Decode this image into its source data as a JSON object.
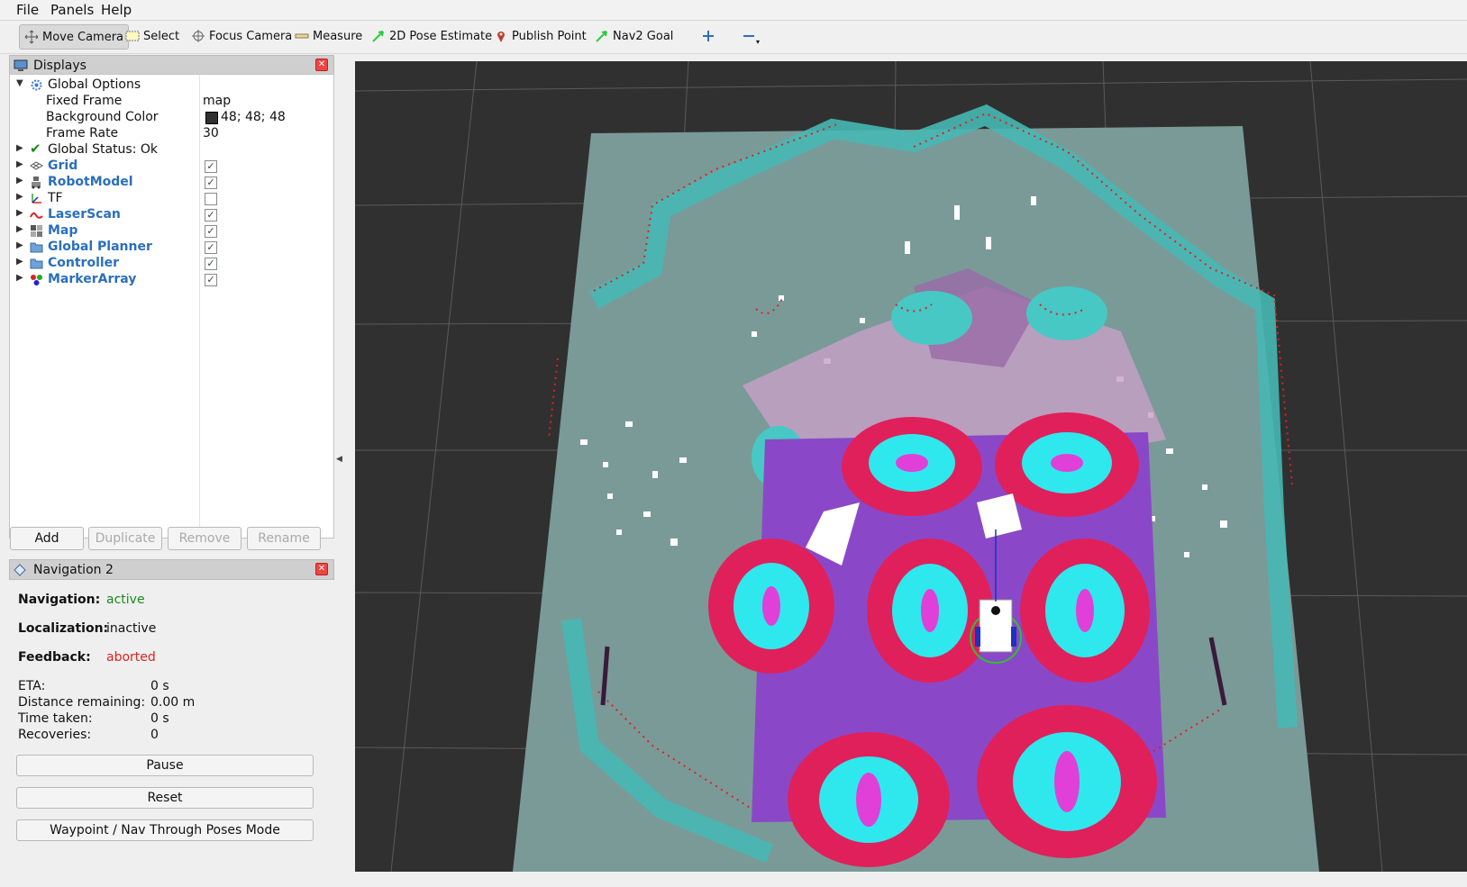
{
  "menubar": {
    "items": [
      "File",
      "Panels",
      "Help"
    ]
  },
  "toolbar": {
    "tools": [
      {
        "label": "Move Camera",
        "icon": "move-camera-icon",
        "active": true
      },
      {
        "label": "Select",
        "icon": "select-icon"
      },
      {
        "label": "Focus Camera",
        "icon": "focus-camera-icon"
      },
      {
        "label": "Measure",
        "icon": "measure-icon"
      },
      {
        "label": "2D Pose Estimate",
        "icon": "pose-arrow-icon",
        "color": "#2ecc40"
      },
      {
        "label": "Publish Point",
        "icon": "map-pin-icon",
        "color": "#c0392b"
      },
      {
        "label": "Nav2 Goal",
        "icon": "goal-arrow-icon",
        "color": "#2ecc40"
      }
    ],
    "add_tool_icon": "plus-icon",
    "remove_tool_icon": "minus-icon"
  },
  "displays": {
    "title": "Displays",
    "global_options": {
      "label": "Global Options",
      "fixed_frame_label": "Fixed Frame",
      "fixed_frame_value": "map",
      "bg_color_label": "Background Color",
      "bg_color_value": "48; 48; 48",
      "bg_color_hex": "#303030",
      "frame_rate_label": "Frame Rate",
      "frame_rate_value": "30"
    },
    "global_status": "Global Status: Ok",
    "items": [
      {
        "label": "Grid",
        "checked": true,
        "icon": "grid-icon"
      },
      {
        "label": "RobotModel",
        "checked": true,
        "icon": "robot-icon"
      },
      {
        "label": "TF",
        "checked": false,
        "icon": "tf-axes-icon"
      },
      {
        "label": "LaserScan",
        "checked": true,
        "icon": "laser-scan-icon"
      },
      {
        "label": "Map",
        "checked": true,
        "icon": "map-icon"
      },
      {
        "label": "Global Planner",
        "checked": true,
        "icon": "folder-icon"
      },
      {
        "label": "Controller",
        "checked": true,
        "icon": "folder-icon"
      },
      {
        "label": "MarkerArray",
        "checked": true,
        "icon": "marker-array-icon"
      }
    ],
    "buttons": {
      "add": "Add",
      "duplicate": "Duplicate",
      "remove": "Remove",
      "rename": "Rename"
    }
  },
  "navigation": {
    "title": "Navigation 2",
    "navigation_label": "Navigation:",
    "navigation_value": "active",
    "localization_label": "Localization:",
    "localization_value": "inactive",
    "feedback_label": "Feedback:",
    "feedback_value": "aborted",
    "eta_label": "ETA:",
    "eta_value": "0 s",
    "distance_label": "Distance remaining:",
    "distance_value": "0.00 m",
    "time_label": "Time taken:",
    "time_value": "0 s",
    "recoveries_label": "Recoveries:",
    "recoveries_value": "0",
    "pause": "Pause",
    "reset": "Reset",
    "waypoint_mode": "Waypoint / Nav Through Poses Mode",
    "colors": {
      "active": "#1a8a1a",
      "aborted": "#e02020"
    }
  }
}
